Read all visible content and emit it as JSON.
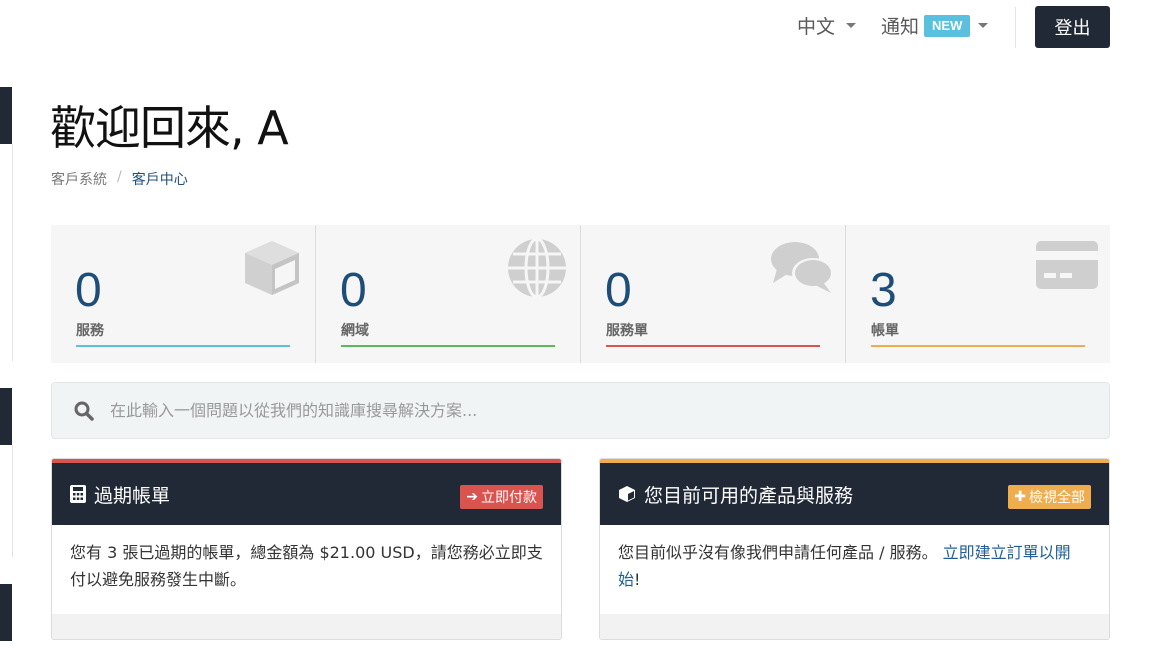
{
  "topbar": {
    "language": "中文",
    "notifications": "通知",
    "notifications_badge": "NEW",
    "logout": "登出"
  },
  "page": {
    "title": "歡迎回來, A",
    "breadcrumb": [
      "客戶系統",
      "客戶中心"
    ],
    "breadcrumb_separator": "/"
  },
  "stats": [
    {
      "value": "0",
      "label": "服務",
      "color": "#5bc0de",
      "icon": "cube-icon"
    },
    {
      "value": "0",
      "label": "網域",
      "color": "#5cb85c",
      "icon": "globe-icon"
    },
    {
      "value": "0",
      "label": "服務單",
      "color": "#d9534f",
      "icon": "comments-icon"
    },
    {
      "value": "3",
      "label": "帳單",
      "color": "#f0ad4e",
      "icon": "credit-card-icon"
    }
  ],
  "search": {
    "placeholder": "在此輸入一個問題以從我們的知識庫搜尋解決方案..."
  },
  "panels": {
    "overdue": {
      "title": "過期帳單",
      "button": "立即付款",
      "body": "您有 3 張已過期的帳單，總金額為 $21.00 USD，請您務必立即支付以避免服務發生中斷。",
      "accent": "#d9534f"
    },
    "products": {
      "title": "您目前可用的產品與服務",
      "button": "檢視全部",
      "body_text": "您目前似乎沒有像我們申請任何產品 / 服務。",
      "body_link": "立即建立訂單以開始",
      "body_end": "!",
      "accent": "#f0ad4e"
    }
  }
}
